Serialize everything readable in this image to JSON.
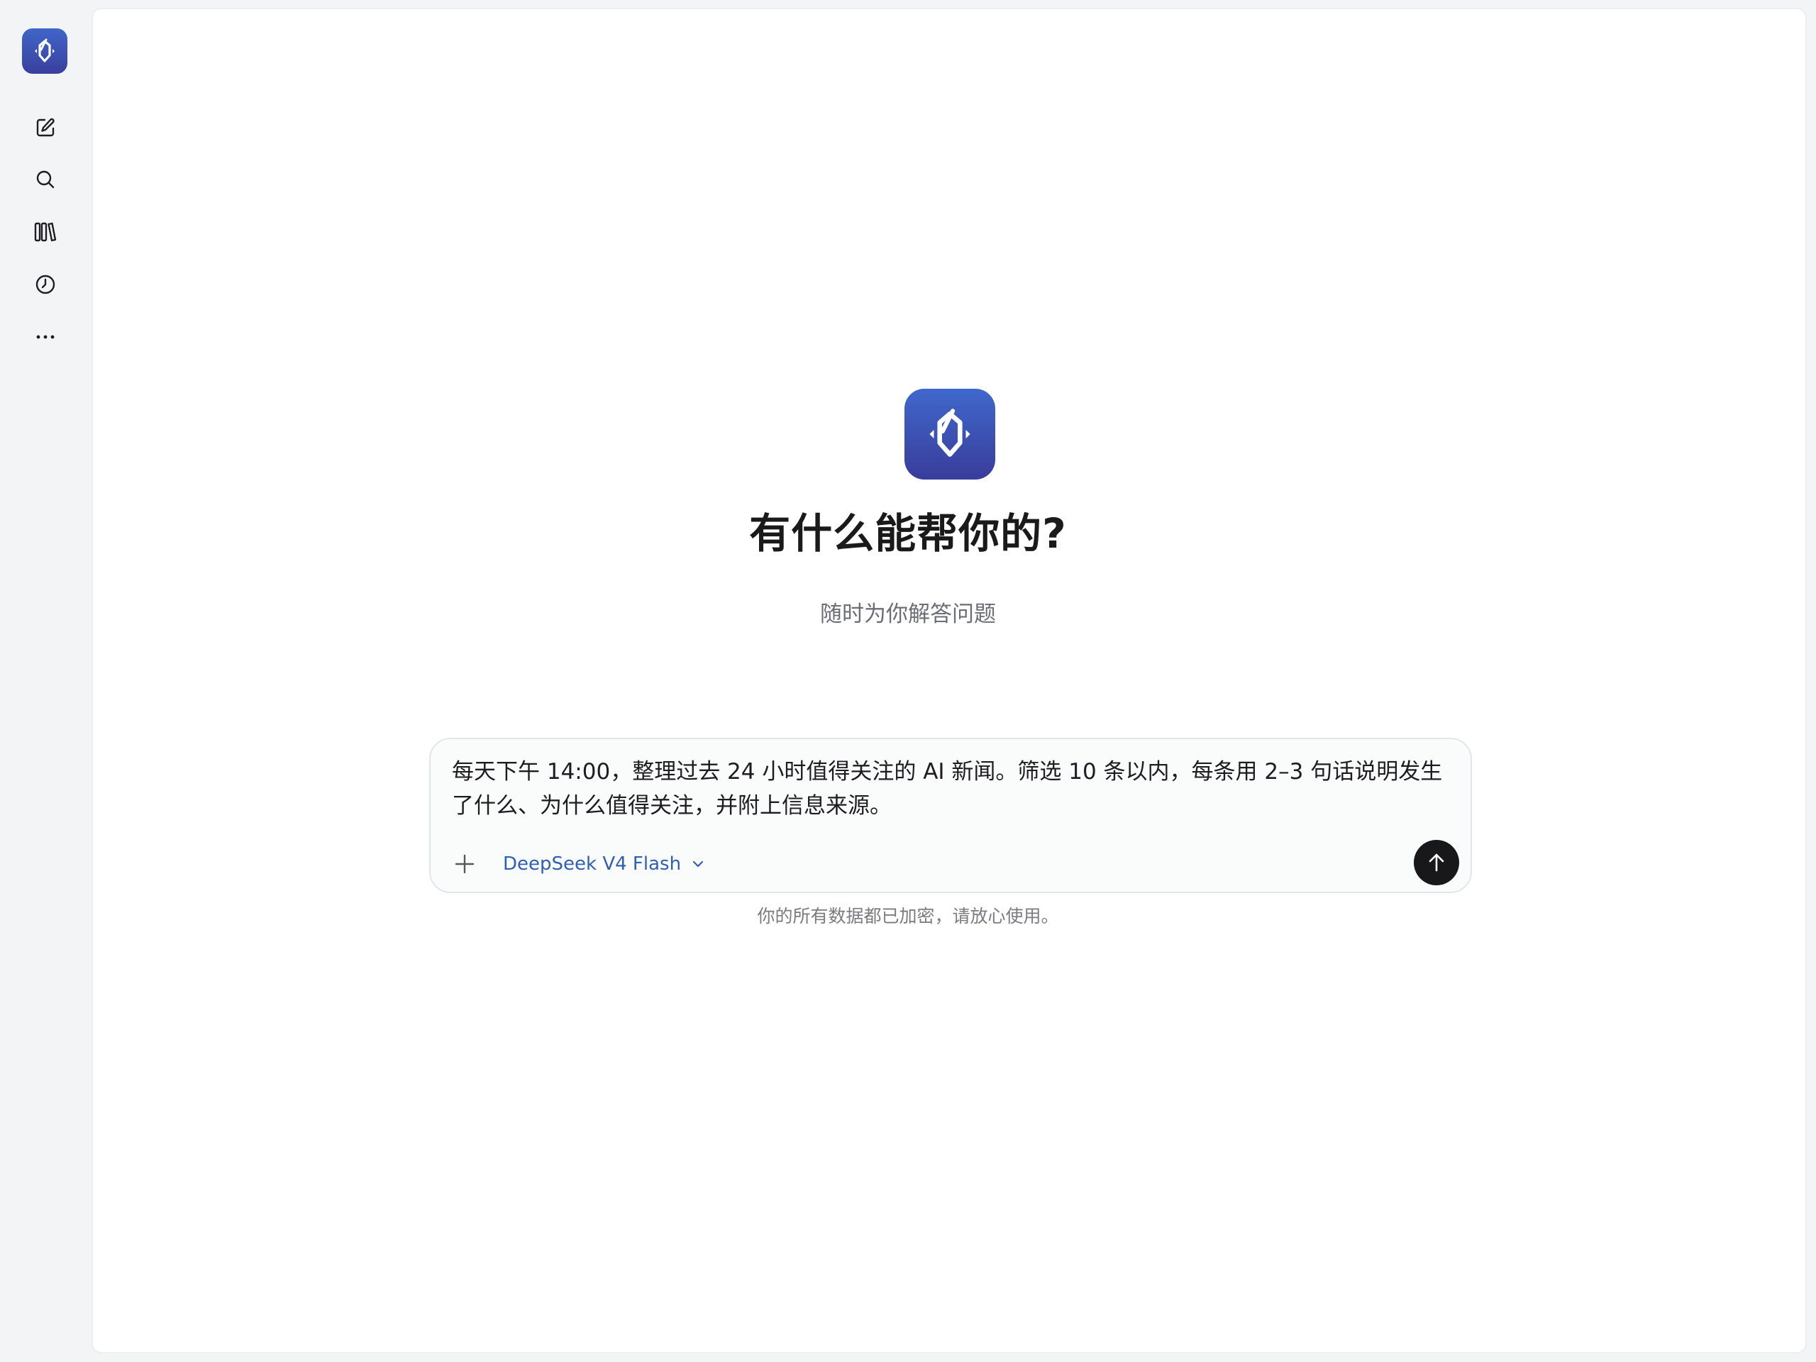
{
  "colors": {
    "brand_gradient_top": "#3f68cc",
    "brand_gradient_bottom": "#393c9a",
    "model_link": "#2f5fb3",
    "send_button": "#18181a"
  },
  "sidebar": {
    "logo_icon": "app-logo-icon",
    "items": [
      {
        "name": "new-chat",
        "icon": "edit-icon"
      },
      {
        "name": "search",
        "icon": "search-icon"
      },
      {
        "name": "library",
        "icon": "library-icon"
      },
      {
        "name": "history",
        "icon": "clock-icon"
      },
      {
        "name": "more",
        "icon": "more-icon"
      }
    ]
  },
  "hero": {
    "title": "有什么能帮你的?",
    "subtitle": "随时为你解答问题"
  },
  "composer": {
    "input_value": "每天下午 14:00，整理过去 24 小时值得关注的 AI 新闻。筛选 10 条以内，每条用 2–3 句话说明发生了什么、为什么值得关注，并附上信息来源。",
    "model_label": "DeepSeek V4 Flash",
    "attach_icon": "plus-icon",
    "send_icon": "arrow-up-icon"
  },
  "footer": {
    "privacy_note": "你的所有数据都已加密，请放心使用。"
  }
}
